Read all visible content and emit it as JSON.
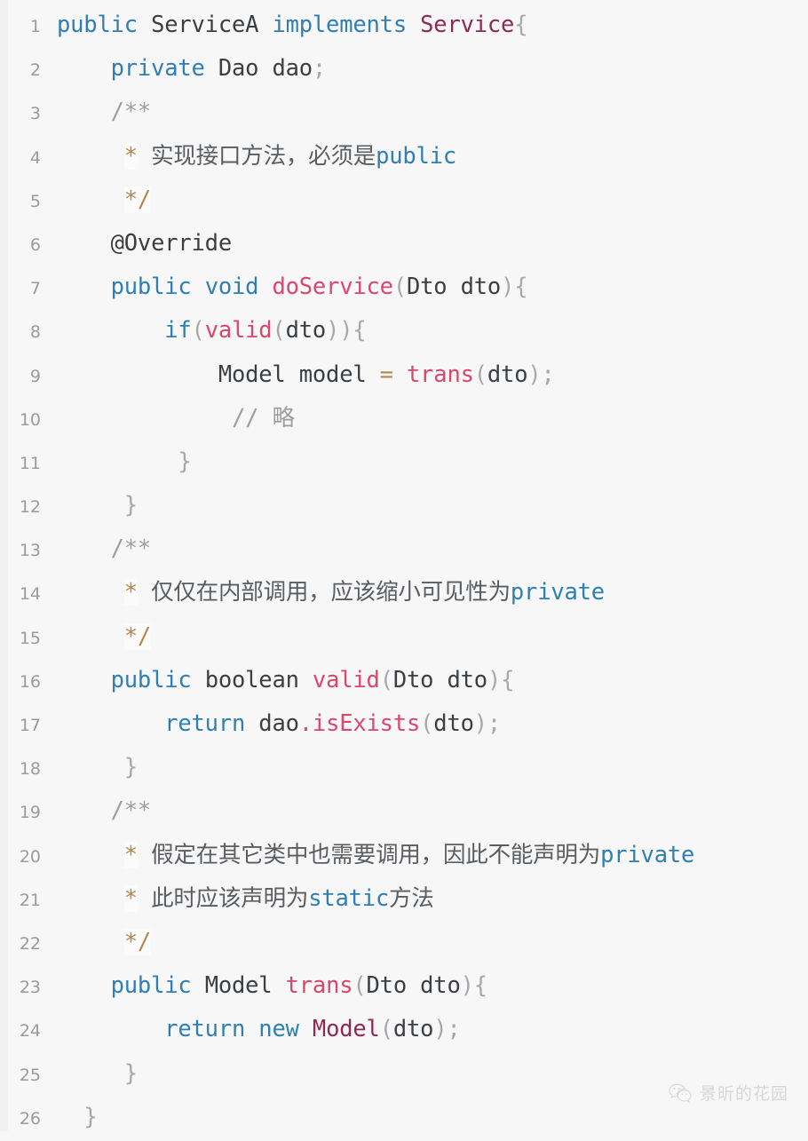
{
  "editor": {
    "title": "Java source code snippet",
    "language": "java",
    "background_color": "#f7f7f8",
    "line_number_color": "#9b9b9e",
    "total_lines": 26,
    "colors": {
      "keyword": "#2f7fb5",
      "class_name": "#8e2a53",
      "method_name": "#d9476c",
      "plain_text": "#3c3f41",
      "punctuation": "#a8a8ac",
      "operator": "#b4874a",
      "comment": "#9d9d9f",
      "comment_marker": "#b4874a"
    }
  },
  "code_lines": [
    {
      "number": "1",
      "tokens": [
        {
          "t": "public",
          "c": "tok-kw"
        },
        {
          "t": " ",
          "c": "tok-plain"
        },
        {
          "t": "ServiceA",
          "c": "tok-plain"
        },
        {
          "t": " ",
          "c": "tok-plain"
        },
        {
          "t": "implements",
          "c": "tok-kw"
        },
        {
          "t": " ",
          "c": "tok-plain"
        },
        {
          "t": "Service",
          "c": "tok-cls"
        },
        {
          "t": "{",
          "c": "tok-punct"
        }
      ]
    },
    {
      "number": "2",
      "tokens": [
        {
          "t": "    ",
          "c": "tok-plain"
        },
        {
          "t": "private",
          "c": "tok-kw"
        },
        {
          "t": " ",
          "c": "tok-plain"
        },
        {
          "t": "Dao",
          "c": "tok-type"
        },
        {
          "t": " ",
          "c": "tok-plain"
        },
        {
          "t": "dao",
          "c": "tok-plain"
        },
        {
          "t": ";",
          "c": "tok-punct"
        }
      ]
    },
    {
      "number": "3",
      "tokens": [
        {
          "t": "    ",
          "c": "tok-plain"
        },
        {
          "t": "/**",
          "c": "tok-cmt"
        }
      ]
    },
    {
      "number": "4",
      "tokens": [
        {
          "t": "     ",
          "c": "tok-plain"
        },
        {
          "t": "*",
          "c": "tok-star"
        },
        {
          "t": " ",
          "c": "tok-plain"
        },
        {
          "t": "实现接口方法，必须是",
          "c": "tok-cmt-txt"
        },
        {
          "t": "public",
          "c": "tok-kw"
        }
      ]
    },
    {
      "number": "5",
      "tokens": [
        {
          "t": "     ",
          "c": "tok-plain"
        },
        {
          "t": "*/",
          "c": "tok-star"
        }
      ]
    },
    {
      "number": "6",
      "tokens": [
        {
          "t": "    ",
          "c": "tok-plain"
        },
        {
          "t": "@Override",
          "c": "tok-ann"
        }
      ]
    },
    {
      "number": "7",
      "tokens": [
        {
          "t": "    ",
          "c": "tok-plain"
        },
        {
          "t": "public",
          "c": "tok-kw"
        },
        {
          "t": " ",
          "c": "tok-plain"
        },
        {
          "t": "void",
          "c": "tok-kw"
        },
        {
          "t": " ",
          "c": "tok-plain"
        },
        {
          "t": "doService",
          "c": "tok-fn"
        },
        {
          "t": "(",
          "c": "tok-punct"
        },
        {
          "t": "Dto",
          "c": "tok-type"
        },
        {
          "t": " ",
          "c": "tok-plain"
        },
        {
          "t": "dto",
          "c": "tok-plain"
        },
        {
          "t": ")",
          "c": "tok-punct"
        },
        {
          "t": "{",
          "c": "tok-punct"
        }
      ]
    },
    {
      "number": "8",
      "tokens": [
        {
          "t": "        ",
          "c": "tok-plain"
        },
        {
          "t": "if",
          "c": "tok-kw"
        },
        {
          "t": "(",
          "c": "tok-punct"
        },
        {
          "t": "valid",
          "c": "tok-fn"
        },
        {
          "t": "(",
          "c": "tok-punct"
        },
        {
          "t": "dto",
          "c": "tok-plain"
        },
        {
          "t": "))",
          "c": "tok-punct"
        },
        {
          "t": "{",
          "c": "tok-punct"
        }
      ]
    },
    {
      "number": "9",
      "tokens": [
        {
          "t": "            ",
          "c": "tok-plain"
        },
        {
          "t": "Model",
          "c": "tok-type"
        },
        {
          "t": " ",
          "c": "tok-plain"
        },
        {
          "t": "model",
          "c": "tok-plain"
        },
        {
          "t": " ",
          "c": "tok-plain"
        },
        {
          "t": "=",
          "c": "tok-op"
        },
        {
          "t": " ",
          "c": "tok-plain"
        },
        {
          "t": "trans",
          "c": "tok-fn"
        },
        {
          "t": "(",
          "c": "tok-punct"
        },
        {
          "t": "dto",
          "c": "tok-plain"
        },
        {
          "t": ");",
          "c": "tok-punct"
        }
      ]
    },
    {
      "number": "10",
      "tokens": [
        {
          "t": "             ",
          "c": "tok-plain"
        },
        {
          "t": "// 略",
          "c": "tok-cmt"
        }
      ]
    },
    {
      "number": "11",
      "tokens": [
        {
          "t": "         ",
          "c": "tok-plain"
        },
        {
          "t": "}",
          "c": "tok-punct"
        }
      ]
    },
    {
      "number": "12",
      "tokens": [
        {
          "t": "     ",
          "c": "tok-plain"
        },
        {
          "t": "}",
          "c": "tok-punct"
        }
      ]
    },
    {
      "number": "13",
      "tokens": [
        {
          "t": "    ",
          "c": "tok-plain"
        },
        {
          "t": "/**",
          "c": "tok-cmt"
        }
      ]
    },
    {
      "number": "14",
      "tokens": [
        {
          "t": "     ",
          "c": "tok-plain"
        },
        {
          "t": "*",
          "c": "tok-star"
        },
        {
          "t": " ",
          "c": "tok-plain"
        },
        {
          "t": "仅仅在内部调用，应该缩小可见性为",
          "c": "tok-cmt-txt"
        },
        {
          "t": "private",
          "c": "tok-kw"
        }
      ]
    },
    {
      "number": "15",
      "tokens": [
        {
          "t": "     ",
          "c": "tok-plain"
        },
        {
          "t": "*/",
          "c": "tok-star"
        }
      ]
    },
    {
      "number": "16",
      "tokens": [
        {
          "t": "    ",
          "c": "tok-plain"
        },
        {
          "t": "public",
          "c": "tok-kw"
        },
        {
          "t": " ",
          "c": "tok-plain"
        },
        {
          "t": "boolean",
          "c": "tok-type"
        },
        {
          "t": " ",
          "c": "tok-plain"
        },
        {
          "t": "valid",
          "c": "tok-fn"
        },
        {
          "t": "(",
          "c": "tok-punct"
        },
        {
          "t": "Dto",
          "c": "tok-type"
        },
        {
          "t": " ",
          "c": "tok-plain"
        },
        {
          "t": "dto",
          "c": "tok-plain"
        },
        {
          "t": ")",
          "c": "tok-punct"
        },
        {
          "t": "{",
          "c": "tok-punct"
        }
      ]
    },
    {
      "number": "17",
      "tokens": [
        {
          "t": "        ",
          "c": "tok-plain"
        },
        {
          "t": "return",
          "c": "tok-kw"
        },
        {
          "t": " ",
          "c": "tok-plain"
        },
        {
          "t": "dao",
          "c": "tok-plain"
        },
        {
          "t": ".",
          "c": "tok-dot"
        },
        {
          "t": "isExists",
          "c": "tok-fn"
        },
        {
          "t": "(",
          "c": "tok-punct"
        },
        {
          "t": "dto",
          "c": "tok-plain"
        },
        {
          "t": ");",
          "c": "tok-punct"
        }
      ]
    },
    {
      "number": "18",
      "tokens": [
        {
          "t": "     ",
          "c": "tok-plain"
        },
        {
          "t": "}",
          "c": "tok-punct"
        }
      ]
    },
    {
      "number": "19",
      "tokens": [
        {
          "t": "    ",
          "c": "tok-plain"
        },
        {
          "t": "/**",
          "c": "tok-cmt"
        }
      ]
    },
    {
      "number": "20",
      "tokens": [
        {
          "t": "     ",
          "c": "tok-plain"
        },
        {
          "t": "*",
          "c": "tok-star"
        },
        {
          "t": " ",
          "c": "tok-plain"
        },
        {
          "t": "假定在其它类中也需要调用，因此不能声明为",
          "c": "tok-cmt-txt"
        },
        {
          "t": "private",
          "c": "tok-kw"
        }
      ]
    },
    {
      "number": "21",
      "tokens": [
        {
          "t": "     ",
          "c": "tok-plain"
        },
        {
          "t": "*",
          "c": "tok-star"
        },
        {
          "t": " ",
          "c": "tok-plain"
        },
        {
          "t": "此时应该声明为",
          "c": "tok-cmt-txt"
        },
        {
          "t": "static",
          "c": "tok-kw"
        },
        {
          "t": "方法",
          "c": "tok-cmt-txt"
        }
      ]
    },
    {
      "number": "22",
      "tokens": [
        {
          "t": "     ",
          "c": "tok-plain"
        },
        {
          "t": "*/",
          "c": "tok-star"
        }
      ]
    },
    {
      "number": "23",
      "tokens": [
        {
          "t": "    ",
          "c": "tok-plain"
        },
        {
          "t": "public",
          "c": "tok-kw"
        },
        {
          "t": " ",
          "c": "tok-plain"
        },
        {
          "t": "Model",
          "c": "tok-type"
        },
        {
          "t": " ",
          "c": "tok-plain"
        },
        {
          "t": "trans",
          "c": "tok-fn"
        },
        {
          "t": "(",
          "c": "tok-punct"
        },
        {
          "t": "Dto",
          "c": "tok-type"
        },
        {
          "t": " ",
          "c": "tok-plain"
        },
        {
          "t": "dto",
          "c": "tok-plain"
        },
        {
          "t": ")",
          "c": "tok-punct"
        },
        {
          "t": "{",
          "c": "tok-punct"
        }
      ]
    },
    {
      "number": "24",
      "tokens": [
        {
          "t": "        ",
          "c": "tok-plain"
        },
        {
          "t": "return",
          "c": "tok-kw"
        },
        {
          "t": " ",
          "c": "tok-plain"
        },
        {
          "t": "new",
          "c": "tok-kw"
        },
        {
          "t": " ",
          "c": "tok-plain"
        },
        {
          "t": "Model",
          "c": "tok-cls"
        },
        {
          "t": "(",
          "c": "tok-punct"
        },
        {
          "t": "dto",
          "c": "tok-plain"
        },
        {
          "t": ");",
          "c": "tok-punct"
        }
      ]
    },
    {
      "number": "25",
      "tokens": [
        {
          "t": "     ",
          "c": "tok-plain"
        },
        {
          "t": "}",
          "c": "tok-punct"
        }
      ]
    },
    {
      "number": "26",
      "tokens": [
        {
          "t": "  ",
          "c": "tok-plain"
        },
        {
          "t": "}",
          "c": "tok-punct"
        }
      ]
    }
  ],
  "watermark": {
    "icon": "wechat-logo-icon",
    "text": "景昕的花园",
    "color": "#8e8e90"
  }
}
